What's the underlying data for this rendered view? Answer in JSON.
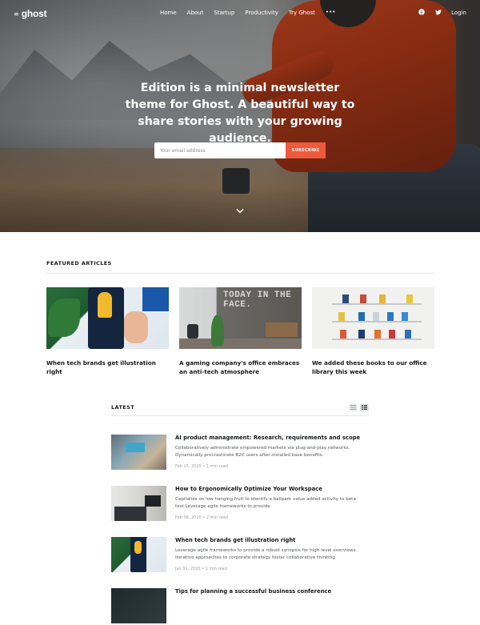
{
  "nav": {
    "logo_text": "ghost",
    "logo_icon": "ghost-mark-icon",
    "menu": [
      "Home",
      "About",
      "Startup",
      "Productivity",
      "Try Ghost"
    ],
    "more_icon": "•••",
    "social": [
      "facebook-icon",
      "twitter-icon"
    ],
    "login": "Login"
  },
  "hero": {
    "title": "Edition is a minimal newsletter theme for Ghost. A beautiful way to share stories with your growing audience.",
    "email_placeholder": "Your email address",
    "subscribe_label": "SUBSCRIBE",
    "scroll_icon": "chevron-down-icon"
  },
  "featured": {
    "label": "FEATURED ARTICLES",
    "articles": [
      {
        "title": "When tech brands get illustration right"
      },
      {
        "title": "A gaming company's office embraces an anti-tech atmosphere",
        "image_text": "TODAY IN THE FACE."
      },
      {
        "title": "We added these books to our office library this week"
      }
    ]
  },
  "latest": {
    "label": "LATEST",
    "posts": [
      {
        "title": "AI product management: Research, requirements and scope",
        "excerpt": "Collaboratively administrate empowered markets via plug-and-play networks. Dynamically procrastinate B2C users after installed base benefits.",
        "date": "Feb 15, 2020",
        "read": "1 min read"
      },
      {
        "title": "How to Ergonomically Optimize Your Workspace",
        "excerpt": "Capitalize on low hanging fruit to identify a ballpark value added activity to beta test.Leverage agile frameworks to provide",
        "date": "Feb 06, 2020",
        "read": "2 min read"
      },
      {
        "title": "When tech brands get illustration right",
        "excerpt": "Leverage agile frameworks to provide a robust synopsis for high level overviews. Iterative approaches to corporate strategy foster collaborative thinking",
        "date": "Jan 31, 2020",
        "read": "1 min read"
      },
      {
        "title": "Tips for planning a successful business conference"
      }
    ]
  },
  "colors": {
    "accent": "#ee5a3b",
    "text": "#15171a",
    "muted": "#9a9ea3"
  }
}
